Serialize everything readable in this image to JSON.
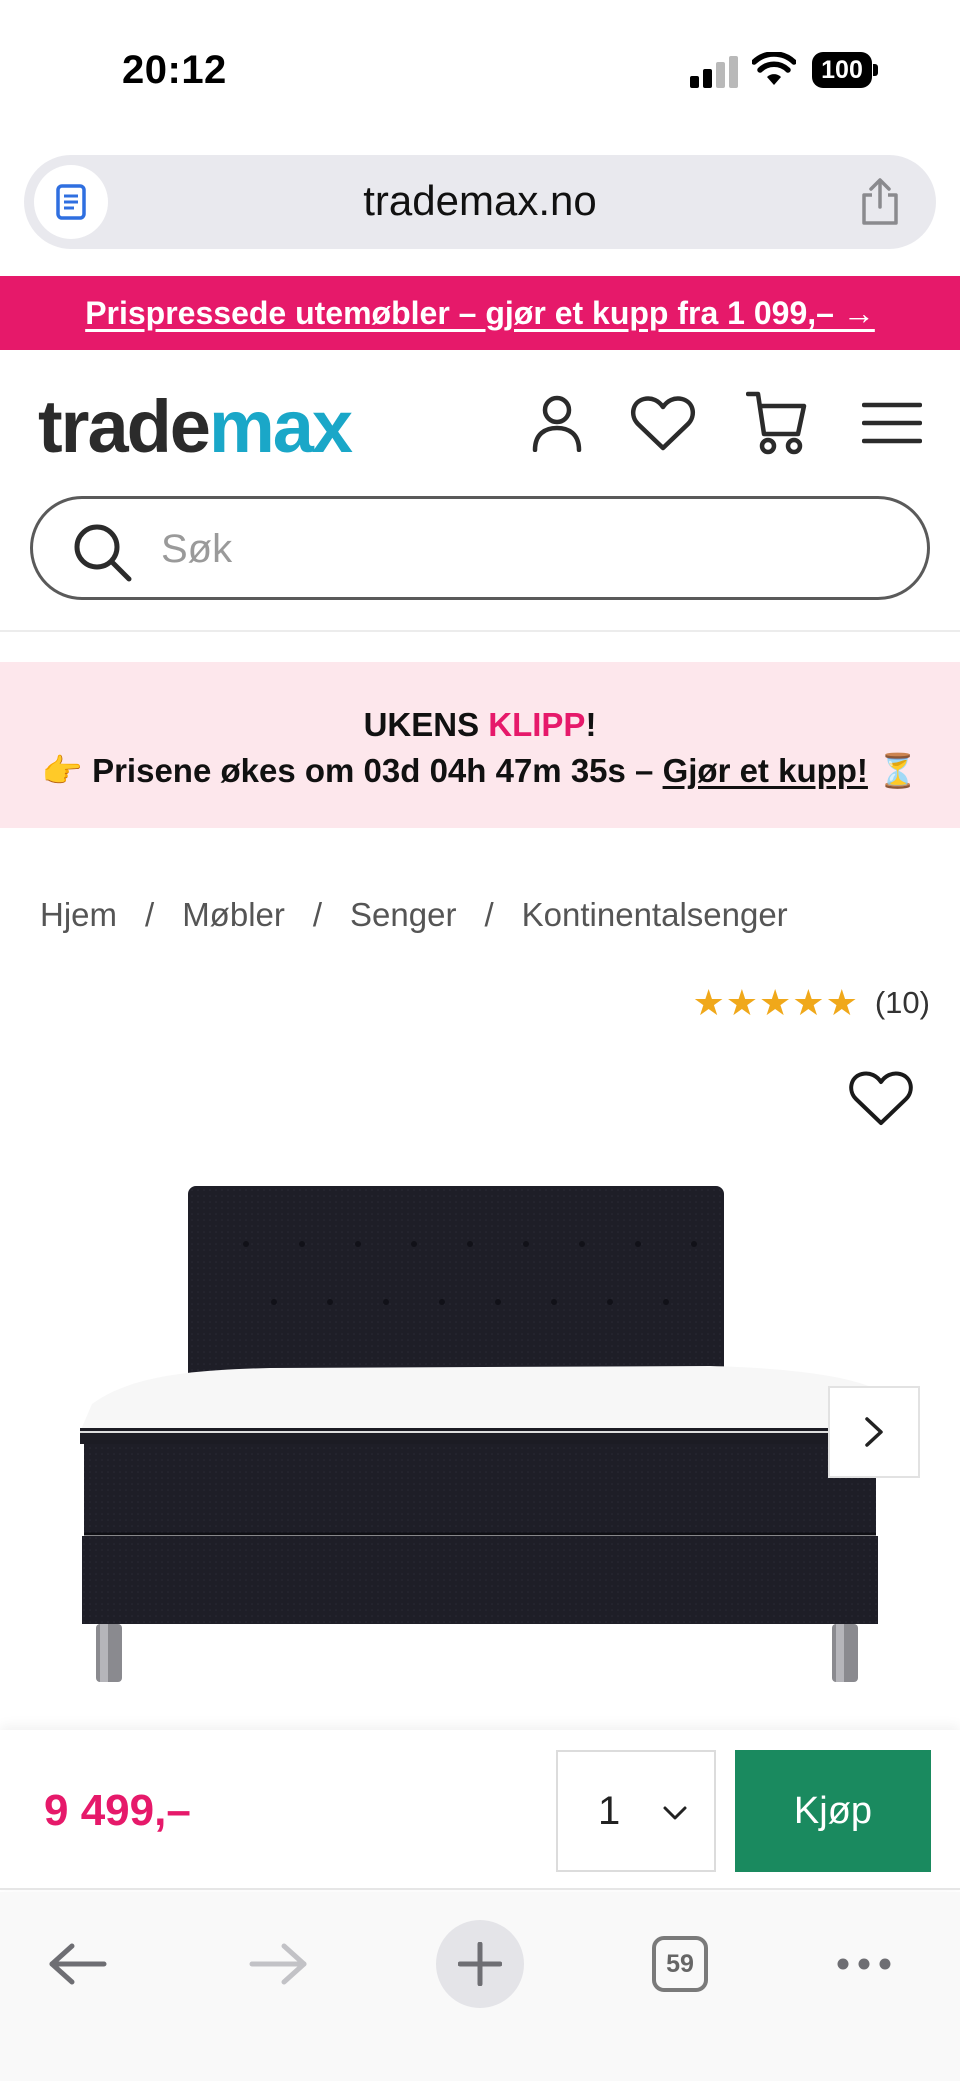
{
  "status_bar": {
    "time": "20:12",
    "battery": "100"
  },
  "browser": {
    "url": "trademax.no",
    "tabs_count": "59"
  },
  "promo": {
    "text": "Prispressede utemøbler – gjør et kupp fra 1 099,– →"
  },
  "header": {
    "logo_part1": "trade",
    "logo_part2": "max"
  },
  "search": {
    "placeholder": "Søk"
  },
  "deal": {
    "title_part1": "UKENS ",
    "title_part2": "KLIPP",
    "title_part3": "!",
    "pointer_emoji": "👉",
    "countdown_text": "Prisene økes om 03d 04h 47m 35s – ",
    "cta": "Gjør et kupp!",
    "hourglass_emoji": "⏳"
  },
  "breadcrumb": [
    "Hjem",
    "Møbler",
    "Senger",
    "Kontinentalsenger"
  ],
  "rating": {
    "stars": "★★★★★",
    "value": 5,
    "count": "(10)"
  },
  "product": {
    "price": "9 499,–",
    "quantity": "1",
    "buy_label": "Kjøp"
  },
  "colors": {
    "brand_pink": "#e6196a",
    "brand_teal": "#1aa7c8",
    "buy_green": "#1a8a5f",
    "star_gold": "#f0a81a"
  },
  "icons": [
    "reader-icon",
    "share-icon",
    "account-icon",
    "heart-icon",
    "cart-icon",
    "menu-icon",
    "search-icon",
    "chevron-right-icon",
    "chevron-down-icon",
    "back-icon",
    "forward-icon",
    "plus-icon",
    "tabs-icon",
    "more-icon"
  ]
}
